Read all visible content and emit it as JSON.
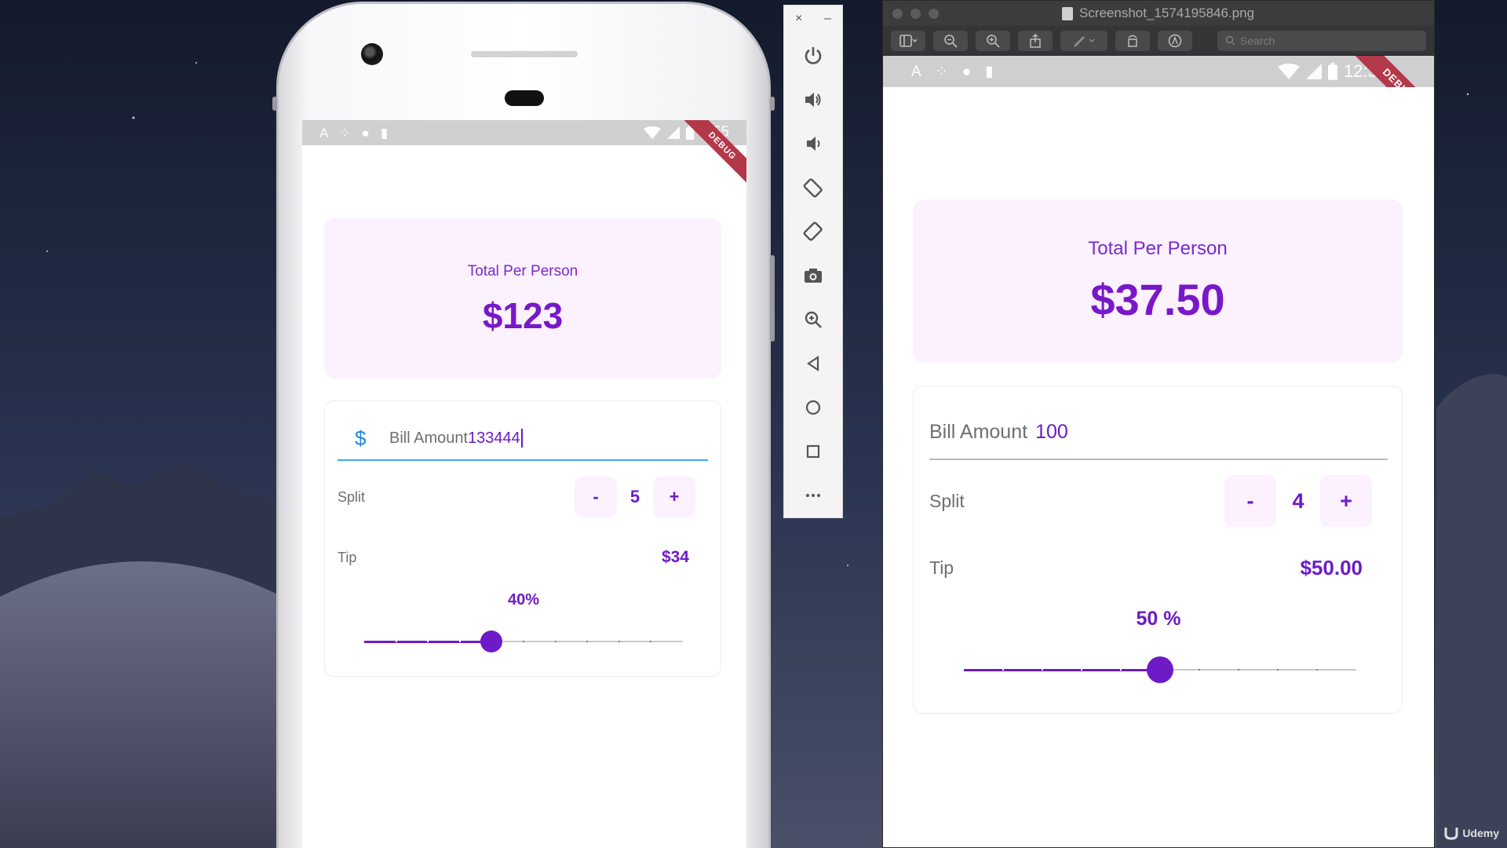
{
  "emulator": {
    "status": {
      "time": "1:55",
      "debug": "DEBUG",
      "glyphs": [
        "A",
        "⁘",
        "●",
        "▮"
      ]
    },
    "app": {
      "total_title": "Total Per Person",
      "total_amount": "$123",
      "bill_icon": "$",
      "bill_label": "Bill Amount",
      "bill_value": "133444",
      "split_label": "Split",
      "split_minus": "-",
      "split_value": "5",
      "split_plus": "+",
      "tip_label": "Tip",
      "tip_amount": "$34",
      "tip_percent_label": "40%",
      "slider": {
        "value": 40,
        "min": 0,
        "max": 100,
        "divisions": 10
      }
    },
    "toolbar": {
      "close": "×",
      "minimize": "–",
      "icons": [
        "power-icon",
        "volume-up-icon",
        "volume-down-icon",
        "rotate-left-icon",
        "rotate-right-icon",
        "camera-icon",
        "zoom-icon",
        "back-icon",
        "home-icon",
        "overview-icon",
        "more-icon"
      ]
    }
  },
  "preview": {
    "title": "Screenshot_1574195846.png",
    "search_placeholder": "Search",
    "status": {
      "time": "12:37",
      "debug": "DEBUG",
      "glyphs": [
        "A",
        "⁘",
        "●",
        "▮"
      ]
    },
    "app": {
      "total_title": "Total Per Person",
      "total_amount": "$37.50",
      "bill_label": "Bill Amount",
      "bill_value": "100",
      "split_label": "Split",
      "split_minus": "-",
      "split_value": "4",
      "split_plus": "+",
      "tip_label": "Tip",
      "tip_amount": "$50.00",
      "tip_percent_label": "50 %",
      "slider": {
        "value": 50,
        "min": 0,
        "max": 100,
        "divisions": 10
      }
    }
  },
  "watermark": "Udemy",
  "colors": {
    "accent": "#6d1bc6",
    "card_bg": "#fbf1ff",
    "field_focus": "#42a5f5",
    "debug_banner": "#b3384a"
  }
}
